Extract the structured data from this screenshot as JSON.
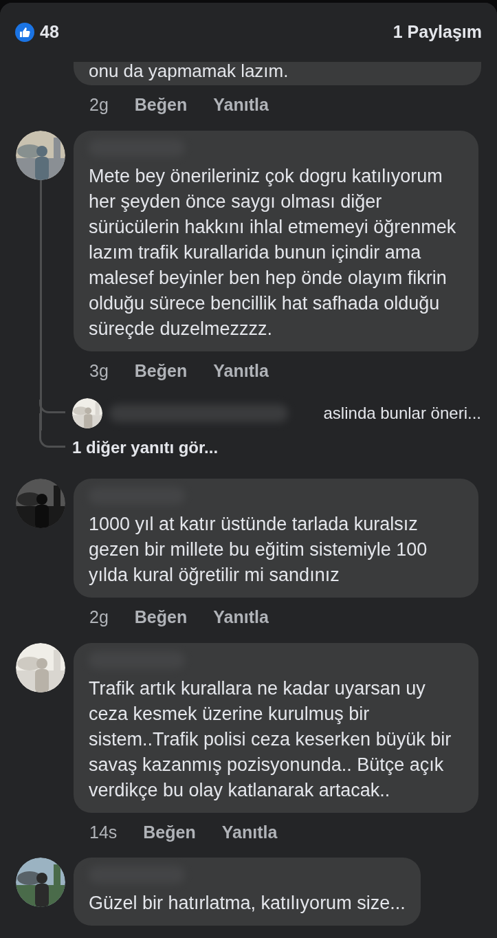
{
  "header": {
    "like_count": "48",
    "shares": "1 Paylaşım"
  },
  "partial_comment": {
    "text": "onu da yapmamak lazım.",
    "time": "2g",
    "actions": [
      "Beğen",
      "Yanıtla"
    ]
  },
  "comments": [
    {
      "text": "Mete bey önerileriniz çok dogru katılıyorum her şeyden önce saygı olması diğer sürücülerin hakkını ihlal etmemeyi öğrenmek lazım trafik kurallarida bunun içindir ama malesef beyinler ben hep önde olayım fikrin olduğu sürece bencillik hat safhada olduğu süreçde duzelmezzzz.",
      "time": "3g",
      "actions": [
        "Beğen",
        "Yanıtla"
      ],
      "reply_preview": {
        "text": "aslinda bunlar öneri..."
      },
      "more_replies": "1 diğer yanıtı gör..."
    },
    {
      "text": "1000 yıl at katır üstünde tarlada kuralsız gezen bir millete bu eğitim sistemiyle 100 yılda kural öğretilir mi sandınız",
      "time": "2g",
      "actions": [
        "Beğen",
        "Yanıtla"
      ]
    },
    {
      "text": "Trafik artık kurallara ne kadar uyarsan uy ceza kesmek üzerine kurulmuş bir sistem..Trafik polisi ceza keserken büyük bir savaş kazanmış pozisyonunda.. Bütçe açık verdikçe bu olay katlanarak artacak..",
      "time": "14s",
      "actions": [
        "Beğen",
        "Yanıtla"
      ]
    },
    {
      "text": "Güzel bir hatırlatma, katılıyorum size..."
    }
  ]
}
